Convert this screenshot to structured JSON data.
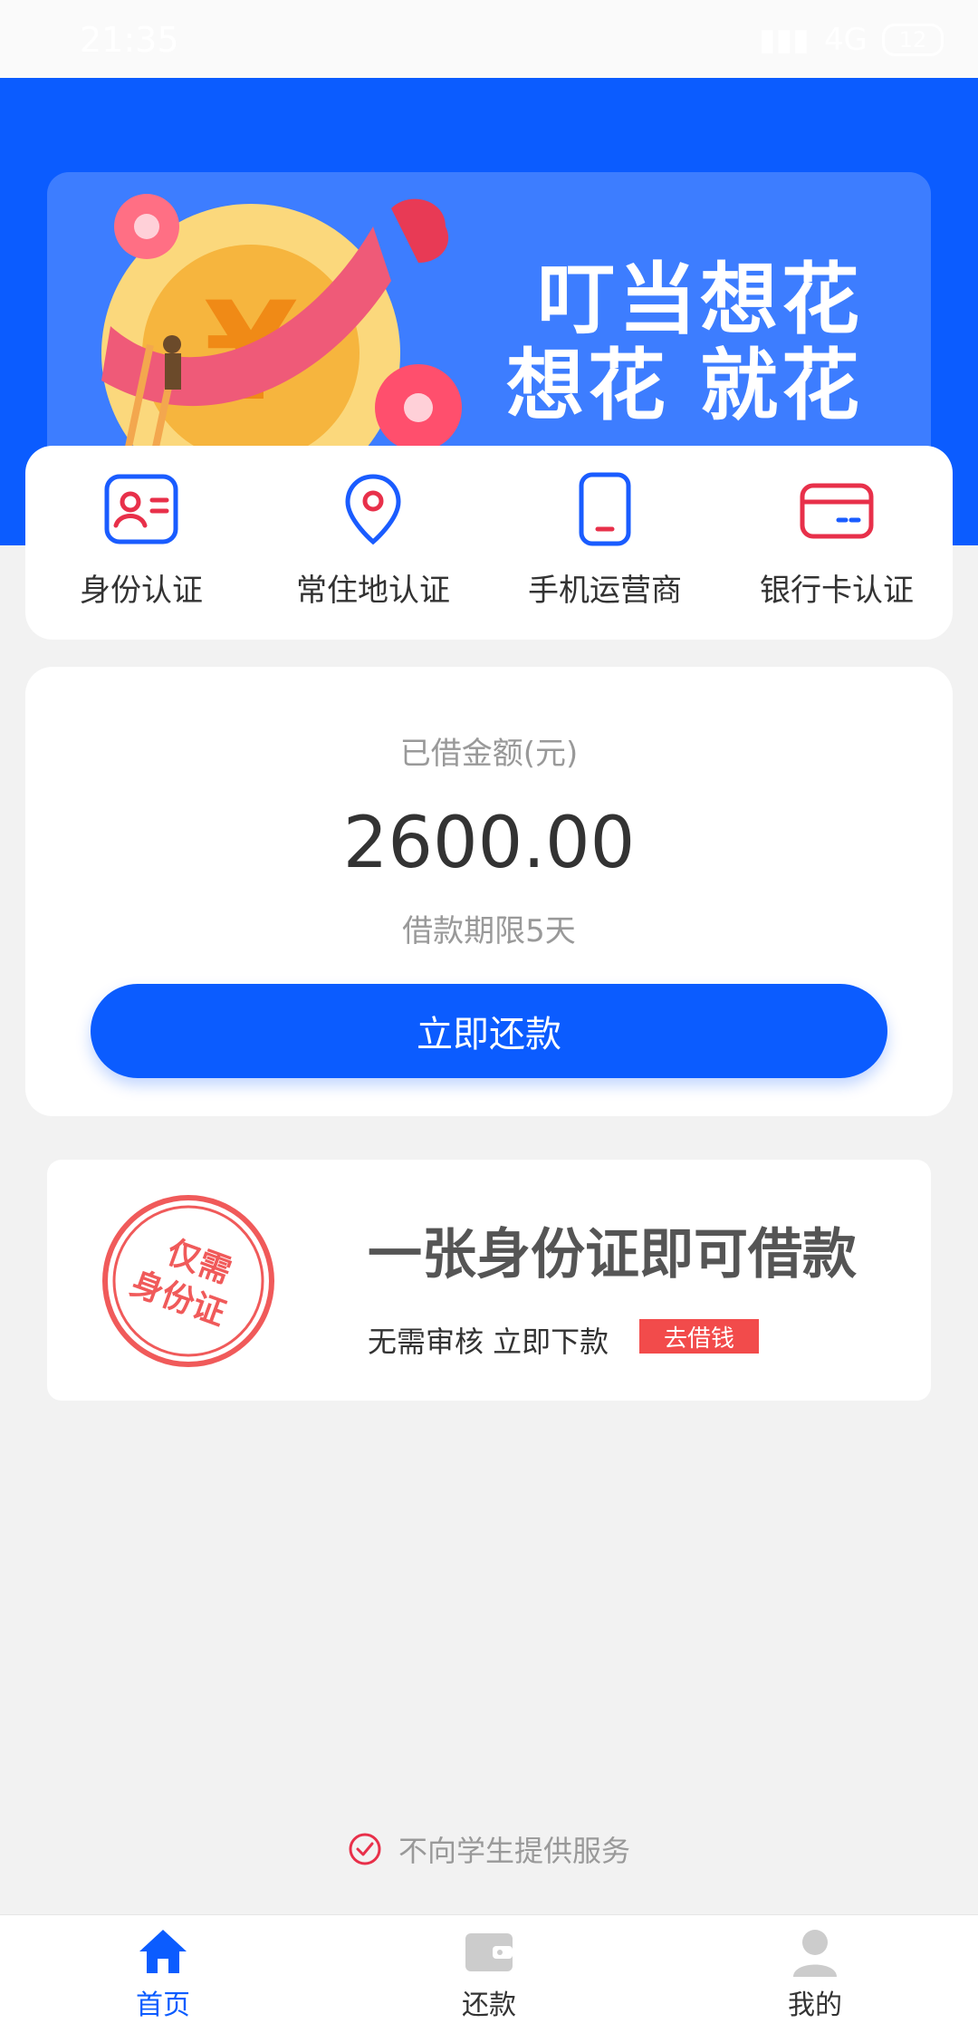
{
  "status_bar": {
    "time": "21:35",
    "network": "4G",
    "battery": "12"
  },
  "banner": {
    "line1": "叮当想花",
    "line2": "想花  就花"
  },
  "auth_items": [
    {
      "label": "身份认证",
      "icon": "id-card-icon"
    },
    {
      "label": "常住地认证",
      "icon": "location-pin-icon"
    },
    {
      "label": "手机运营商",
      "icon": "phone-icon"
    },
    {
      "label": "银行卡认证",
      "icon": "bank-card-icon"
    }
  ],
  "loan": {
    "title": "已借金额(元)",
    "amount": "2600.00",
    "term": "借款期限5天",
    "repay_button": "立即还款"
  },
  "promo": {
    "stamp_line1": "仅需",
    "stamp_line2": "身份证",
    "headline": "一张身份证即可借款",
    "sub": "无需审核 立即下款",
    "tag": "去借钱"
  },
  "notice": "不向学生提供服务",
  "tabs": [
    {
      "label": "首页",
      "icon": "home-icon",
      "active": true
    },
    {
      "label": "还款",
      "icon": "wallet-icon",
      "active": false
    },
    {
      "label": "我的",
      "icon": "user-icon",
      "active": false
    }
  ],
  "colors": {
    "primary": "#0b5cff",
    "accent_red": "#e8304a",
    "tag_red": "#f24b4b"
  }
}
